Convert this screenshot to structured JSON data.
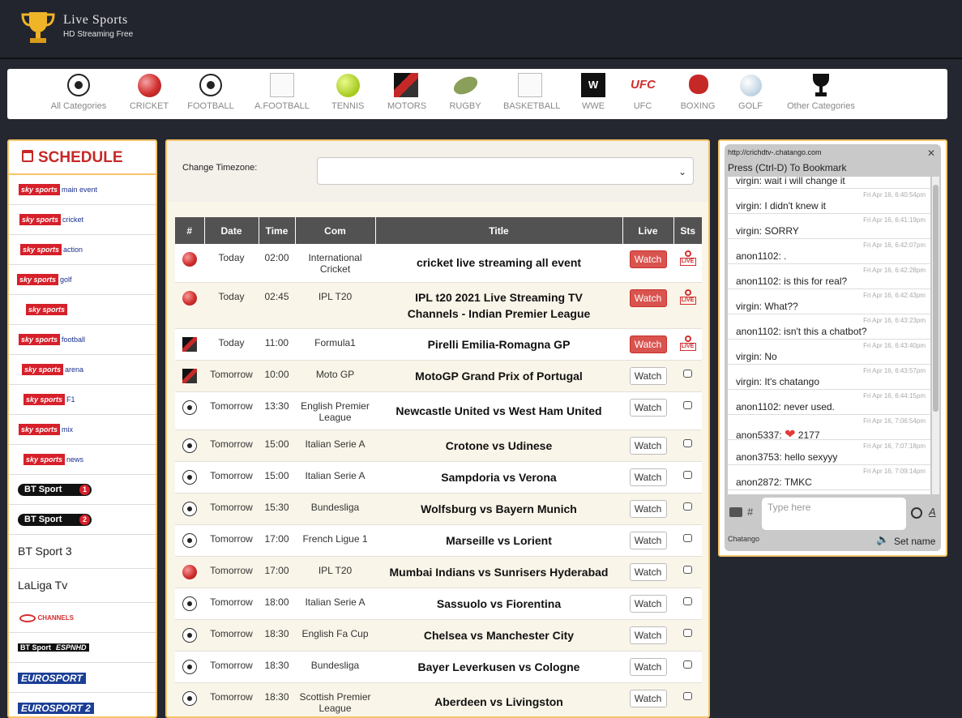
{
  "header": {
    "title": "Live Sports",
    "subtitle": "HD Streaming Free"
  },
  "categories": [
    {
      "label": "All Categories",
      "icon": "soccer-ball-icon"
    },
    {
      "label": "CRICKET",
      "icon": "cricket-ball-icon"
    },
    {
      "label": "FOOTBALL",
      "icon": "soccer-ball-icon"
    },
    {
      "label": "A.FOOTBALL",
      "icon": "broken-image-icon"
    },
    {
      "label": "TENNIS",
      "icon": "tennis-ball-icon"
    },
    {
      "label": "MOTORS",
      "icon": "motors-icon"
    },
    {
      "label": "RUGBY",
      "icon": "rugby-ball-icon"
    },
    {
      "label": "BASKETBALL",
      "icon": "broken-image-icon"
    },
    {
      "label": "WWE",
      "icon": "wwe-icon"
    },
    {
      "label": "UFC",
      "icon": "ufc-icon"
    },
    {
      "label": "BOXING",
      "icon": "boxing-glove-icon"
    },
    {
      "label": "GOLF",
      "icon": "golf-ball-icon"
    },
    {
      "label": "Other Categories",
      "icon": "trophy-icon"
    }
  ],
  "schedule": {
    "title": "SCHEDULE",
    "channels": [
      {
        "brand": "sky sports",
        "suffix": "main event"
      },
      {
        "brand": "sky sports",
        "suffix": "cricket"
      },
      {
        "brand": "sky sports",
        "suffix": "action"
      },
      {
        "brand": "sky sports",
        "suffix": "golf"
      },
      {
        "brand": "sky sports",
        "suffix": ""
      },
      {
        "brand": "sky sports",
        "suffix": "football"
      },
      {
        "brand": "sky sports",
        "suffix": "arena"
      },
      {
        "brand": "sky sports",
        "suffix": "F1"
      },
      {
        "brand": "sky sports",
        "suffix": "mix"
      },
      {
        "brand": "sky sports",
        "suffix": "news"
      },
      {
        "brand": "BT Sport",
        "suffix": "1"
      },
      {
        "brand": "BT Sport",
        "suffix": "2"
      },
      {
        "text": "BT Sport 3"
      },
      {
        "text": "LaLiga Tv"
      },
      {
        "brand": "CHANNELS",
        "suffix": ""
      },
      {
        "brand": "BT Sport",
        "suffix": "ESPNHD"
      },
      {
        "brand": "EUROSPORT",
        "suffix": ""
      },
      {
        "brand": "EUROSPORT",
        "suffix": "2"
      }
    ]
  },
  "timezone": {
    "label": "Change Timezone:",
    "value": ""
  },
  "table": {
    "headers": [
      "#",
      "Date",
      "Time",
      "Com",
      "Title",
      "Live",
      "Sts"
    ],
    "rows": [
      {
        "icon": "cricket",
        "date": "Today",
        "time": "02:00",
        "com": "International Cricket",
        "title": "cricket live streaming all event",
        "watch": "Watch",
        "live": true
      },
      {
        "icon": "cricket",
        "date": "Today",
        "time": "02:45",
        "com": "IPL T20",
        "title": "IPL t20 2021 Live Streaming TV Channels - Indian Premier League",
        "watch": "Watch",
        "live": true
      },
      {
        "icon": "motors",
        "date": "Today",
        "time": "11:00",
        "com": "Formula1",
        "title": "Pirelli Emilia-Romagna GP",
        "watch": "Watch",
        "live": true
      },
      {
        "icon": "motors",
        "date": "Tomorrow",
        "time": "10:00",
        "com": "Moto GP",
        "title": "MotoGP Grand Prix of Portugal",
        "watch": "Watch",
        "live": false
      },
      {
        "icon": "soccer",
        "date": "Tomorrow",
        "time": "13:30",
        "com": "English Premier League",
        "title": "Newcastle United vs West Ham United",
        "watch": "Watch",
        "live": false
      },
      {
        "icon": "soccer",
        "date": "Tomorrow",
        "time": "15:00",
        "com": "Italian Serie A",
        "title": "Crotone vs Udinese",
        "watch": "Watch",
        "live": false
      },
      {
        "icon": "soccer",
        "date": "Tomorrow",
        "time": "15:00",
        "com": "Italian Serie A",
        "title": "Sampdoria vs Verona",
        "watch": "Watch",
        "live": false
      },
      {
        "icon": "soccer",
        "date": "Tomorrow",
        "time": "15:30",
        "com": "Bundesliga",
        "title": "Wolfsburg vs Bayern Munich",
        "watch": "Watch",
        "live": false
      },
      {
        "icon": "soccer",
        "date": "Tomorrow",
        "time": "17:00",
        "com": "French Ligue 1",
        "title": "Marseille vs Lorient",
        "watch": "Watch",
        "live": false
      },
      {
        "icon": "cricket",
        "date": "Tomorrow",
        "time": "17:00",
        "com": "IPL T20",
        "title": "Mumbai Indians vs Sunrisers Hyderabad",
        "watch": "Watch",
        "live": false
      },
      {
        "icon": "soccer",
        "date": "Tomorrow",
        "time": "18:00",
        "com": "Italian Serie A",
        "title": "Sassuolo vs Fiorentina",
        "watch": "Watch",
        "live": false
      },
      {
        "icon": "soccer",
        "date": "Tomorrow",
        "time": "18:30",
        "com": "English Fa Cup",
        "title": "Chelsea vs Manchester City",
        "watch": "Watch",
        "live": false
      },
      {
        "icon": "soccer",
        "date": "Tomorrow",
        "time": "18:30",
        "com": "Bundesliga",
        "title": "Bayer Leverkusen vs Cologne",
        "watch": "Watch",
        "live": false
      },
      {
        "icon": "soccer",
        "date": "Tomorrow",
        "time": "18:30",
        "com": "Scottish Premier League",
        "title": "Aberdeen vs Livingston",
        "watch": "Watch",
        "live": false
      }
    ]
  },
  "chat": {
    "url": "http://crichdtv-.chatango.com",
    "bookmark": "Press (Ctrl-D) To Bookmark",
    "messages": [
      {
        "text": "virgin: wait i will change it",
        "time": ""
      },
      {
        "text": "virgin: I didn't knew it",
        "time": "Fri Apr 16, 6:40:54pm"
      },
      {
        "text": "virgin: SORRY",
        "time": "Fri Apr 16, 6:41:19pm"
      },
      {
        "text": "anon1102: .",
        "time": "Fri Apr 16, 6:42:07pm"
      },
      {
        "text": "anon1102: is this for real?",
        "time": "Fri Apr 16, 6:42:28pm"
      },
      {
        "text": "virgin: What??",
        "time": "Fri Apr 16, 6:42:43pm"
      },
      {
        "text": "anon1102: isn't this a chatbot?",
        "time": "Fri Apr 16, 6:43:23pm"
      },
      {
        "text": "virgin: No",
        "time": "Fri Apr 16, 6:43:40pm"
      },
      {
        "text": "virgin: It's chatango",
        "time": "Fri Apr 16, 6:43:57pm"
      },
      {
        "text": "anon1102: never used.",
        "time": "Fri Apr 16, 6:44:15pm"
      },
      {
        "text": "anon5337: ❤ 2177",
        "time": "Fri Apr 16, 7:06:54pm"
      },
      {
        "text": "anon3753: hello sexyyy",
        "time": "Fri Apr 16, 7:07:18pm"
      },
      {
        "text": "anon2872: TMKC",
        "time": "Fri Apr 16, 7:09:14pm"
      }
    ],
    "placeholder": "Type here",
    "brand": "Chatango",
    "set_name": "Set name",
    "hash": "#",
    "font_label": "A"
  },
  "colors": {
    "accent": "#f5c46a",
    "live_button": "#d9534f",
    "header_bg": "#22252d"
  }
}
